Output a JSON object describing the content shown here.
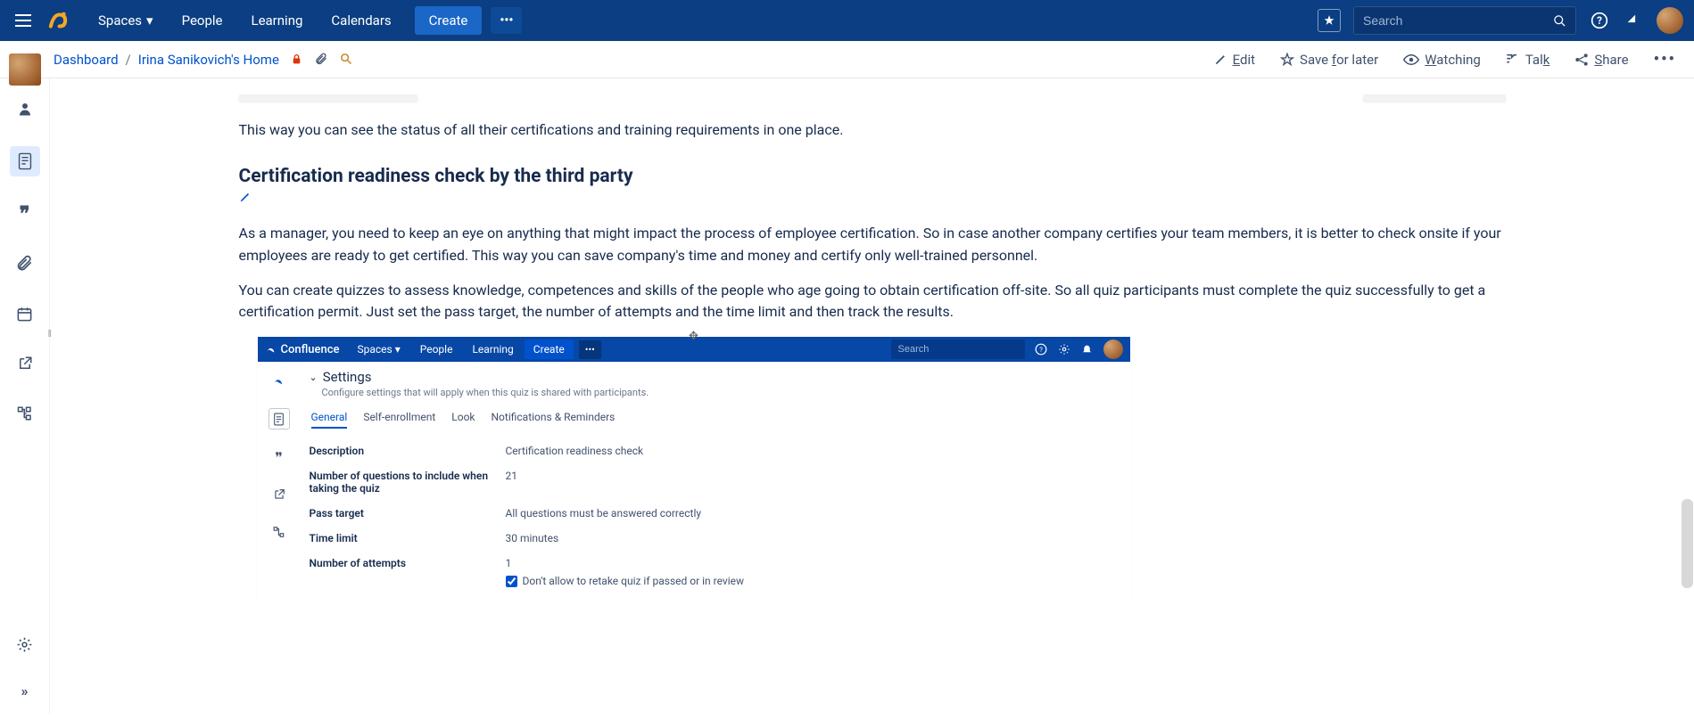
{
  "topbar": {
    "nav": [
      "Spaces",
      "People",
      "Learning",
      "Calendars"
    ],
    "create": "Create",
    "search_placeholder": "Search"
  },
  "breadcrumb": {
    "dashboard": "Dashboard",
    "page": "Irina Sanikovich's Home"
  },
  "page_actions": {
    "edit": "Edit",
    "save": "Save for later",
    "watching": "Watching",
    "talk": "Talk",
    "share": "Share"
  },
  "content": {
    "intro": "This way you can see the status of all their certifications and training requirements in one place.",
    "heading": "Certification readiness check by the third party",
    "p1": "As a manager, you need to keep an eye on anything that might impact the process of employee certification. So in case another company certifies your team members, it is better to check onsite if your employees are ready to get certified. This way you can save company's time and money and certify only well-trained personnel.",
    "p2": "You can create quizzes to assess knowledge, competences and skills of the people who age going to obtain certification off-site. So all quiz participants must complete the quiz successfully to get a certification permit. Just set the pass target, the number of attempts and the time limit and then track the results."
  },
  "embed": {
    "brand": "Confluence",
    "nav": [
      "Spaces",
      "People",
      "Learning"
    ],
    "create": "Create",
    "search_placeholder": "Search",
    "settings_title": "Settings",
    "settings_desc": "Configure settings that will apply when this quiz is shared with participants.",
    "tabs": [
      "General",
      "Self-enrollment",
      "Look",
      "Notifications & Reminders"
    ],
    "rows": [
      {
        "label": "Description",
        "value": "Certification readiness check"
      },
      {
        "label": "Number of questions to include when taking the quiz",
        "value": "21"
      },
      {
        "label": "Pass target",
        "value": "All questions must be answered correctly"
      },
      {
        "label": "Time limit",
        "value": "30 minutes"
      },
      {
        "label": "Number of attempts",
        "value": "1"
      }
    ],
    "checkbox": "Don't allow to retake quiz if passed or in review"
  }
}
